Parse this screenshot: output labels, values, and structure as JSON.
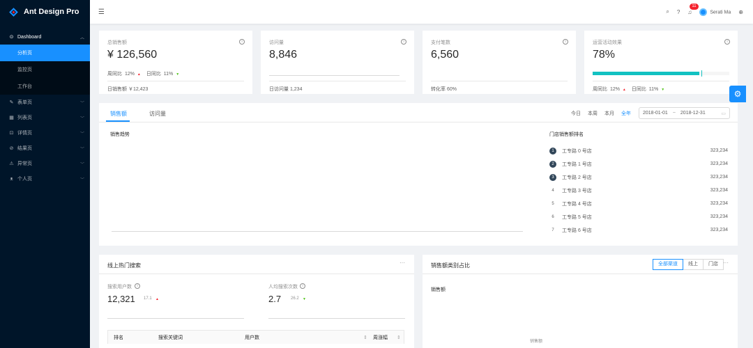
{
  "app": {
    "title": "Ant Design Pro"
  },
  "sidebar": {
    "items": [
      {
        "icon": "dashboard-icon",
        "glyph": "⊙",
        "label": "Dashboard",
        "open": true,
        "children": [
          {
            "label": "分析页",
            "active": true
          },
          {
            "label": "监控页",
            "active": false
          },
          {
            "label": "工作台",
            "active": false
          }
        ]
      },
      {
        "icon": "form-icon",
        "glyph": "✎",
        "label": "表单页"
      },
      {
        "icon": "table-icon",
        "glyph": "▦",
        "label": "列表页"
      },
      {
        "icon": "profile-icon",
        "glyph": "⊡",
        "label": "详情页"
      },
      {
        "icon": "check-circle-icon",
        "glyph": "⊘",
        "label": "结果页"
      },
      {
        "icon": "warning-icon",
        "glyph": "⚠",
        "label": "异常页"
      },
      {
        "icon": "user-icon",
        "glyph": "ᴥ",
        "label": "个人页"
      }
    ]
  },
  "header": {
    "notification_count": "11",
    "username": "Serati Ma"
  },
  "stats": {
    "total_sales": {
      "title": "总销售额",
      "value": "¥ 126,560",
      "week_label": "周同比",
      "week_value": "12%",
      "day_label": "日同比",
      "day_value": "11%",
      "footer": "日销售额 ￥12,423"
    },
    "visits": {
      "title": "访问量",
      "value": "8,846",
      "footer": "日访问量 1,234"
    },
    "payments": {
      "title": "支付笔数",
      "value": "6,560",
      "footer": "转化率 60%"
    },
    "campaign": {
      "title": "运营活动效果",
      "value": "78%",
      "progress": 0.78,
      "week_label": "周同比",
      "week_value": "12%",
      "day_label": "日同比",
      "day_value": "11%"
    }
  },
  "sales_card": {
    "tabs": [
      "销售额",
      "访问量"
    ],
    "ranges": [
      "今日",
      "本周",
      "本月",
      "全年"
    ],
    "active_range": "全年",
    "date_start": "2018-01-01",
    "date_sep": "~",
    "date_end": "2018-12-31",
    "trend_title": "销售趋势",
    "rank_title": "门店销售额排名",
    "rank": [
      {
        "no": "1",
        "name": "工专路 0 号店",
        "value": "323,234"
      },
      {
        "no": "2",
        "name": "工专路 1 号店",
        "value": "323,234"
      },
      {
        "no": "3",
        "name": "工专路 2 号店",
        "value": "323,234"
      },
      {
        "no": "4",
        "name": "工专路 3 号店",
        "value": "323,234"
      },
      {
        "no": "5",
        "name": "工专路 4 号店",
        "value": "323,234"
      },
      {
        "no": "6",
        "name": "工专路 5 号店",
        "value": "323,234"
      },
      {
        "no": "7",
        "name": "工专路 6 号店",
        "value": "323,234"
      }
    ]
  },
  "search_card": {
    "title": "线上热门搜索",
    "more": "···",
    "users_title": "搜索用户数",
    "users_value": "12,321",
    "users_change": "17.1",
    "per_user_title": "人均搜索次数",
    "per_user_value": "2.7",
    "per_user_change": "26.2",
    "columns": [
      "排名",
      "搜索关键词",
      "用户数",
      "周涨幅"
    ]
  },
  "category_card": {
    "title": "销售额类别占比",
    "options": [
      "全部渠道",
      "线上",
      "门店"
    ],
    "active_option": "全部渠道",
    "more": "···",
    "label": "销售额",
    "center_label": "销售额"
  }
}
